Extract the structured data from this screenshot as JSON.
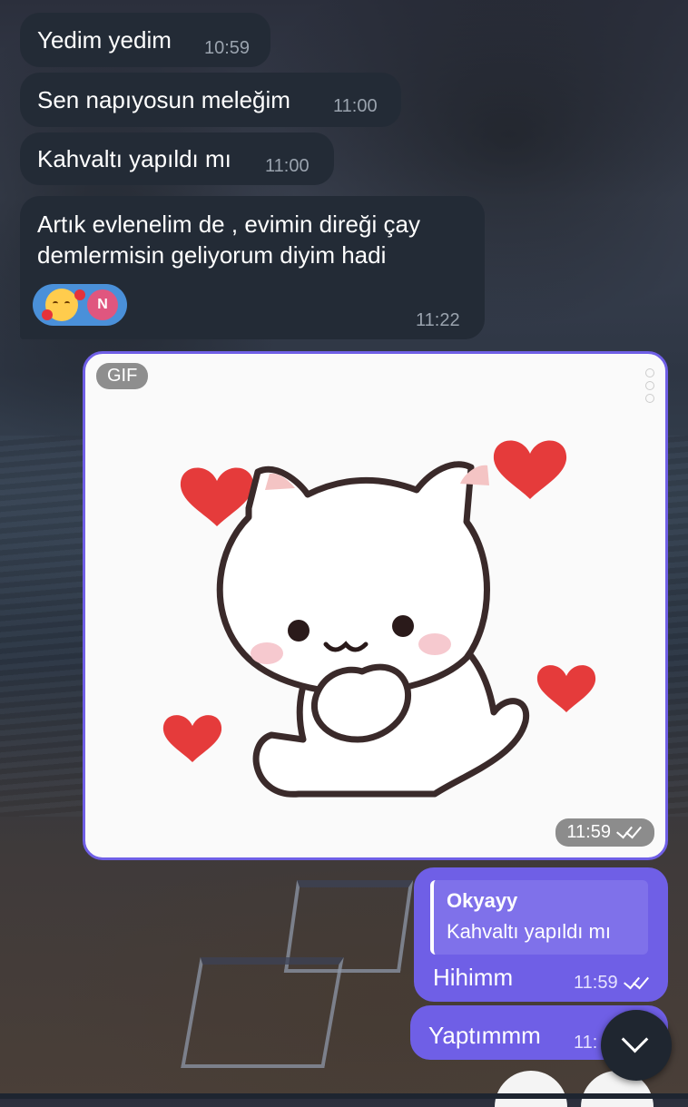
{
  "messages": [
    {
      "text": "Yedim yedim",
      "time": "10:59"
    },
    {
      "text": "Sen napıyosun meleğim",
      "time": "11:00"
    },
    {
      "text": "Kahvaltı yapıldı mı",
      "time": "11:00"
    },
    {
      "text": "Artık evlenelim de , evimin direği çay demlermisin geliyorum diyim hadi",
      "time": "11:22",
      "reaction": {
        "emoji_name": "smiling-face-with-hearts-icon",
        "avatar_initial": "N"
      }
    }
  ],
  "gif_message": {
    "badge": "GIF",
    "time": "11:59",
    "sticker_name": "cat-with-hearts-sticker"
  },
  "reply_message": {
    "quote_author": "Okyayy",
    "quote_text": "Kahvaltı yapıldı mı",
    "text": "Hihimm",
    "time": "11:59"
  },
  "last_message": {
    "text": "Yaptımmm",
    "time_visible": "11:"
  },
  "colors": {
    "incoming": "#232b36",
    "outgoing": "#6f5fe6",
    "reaction": "#4a90d9"
  }
}
